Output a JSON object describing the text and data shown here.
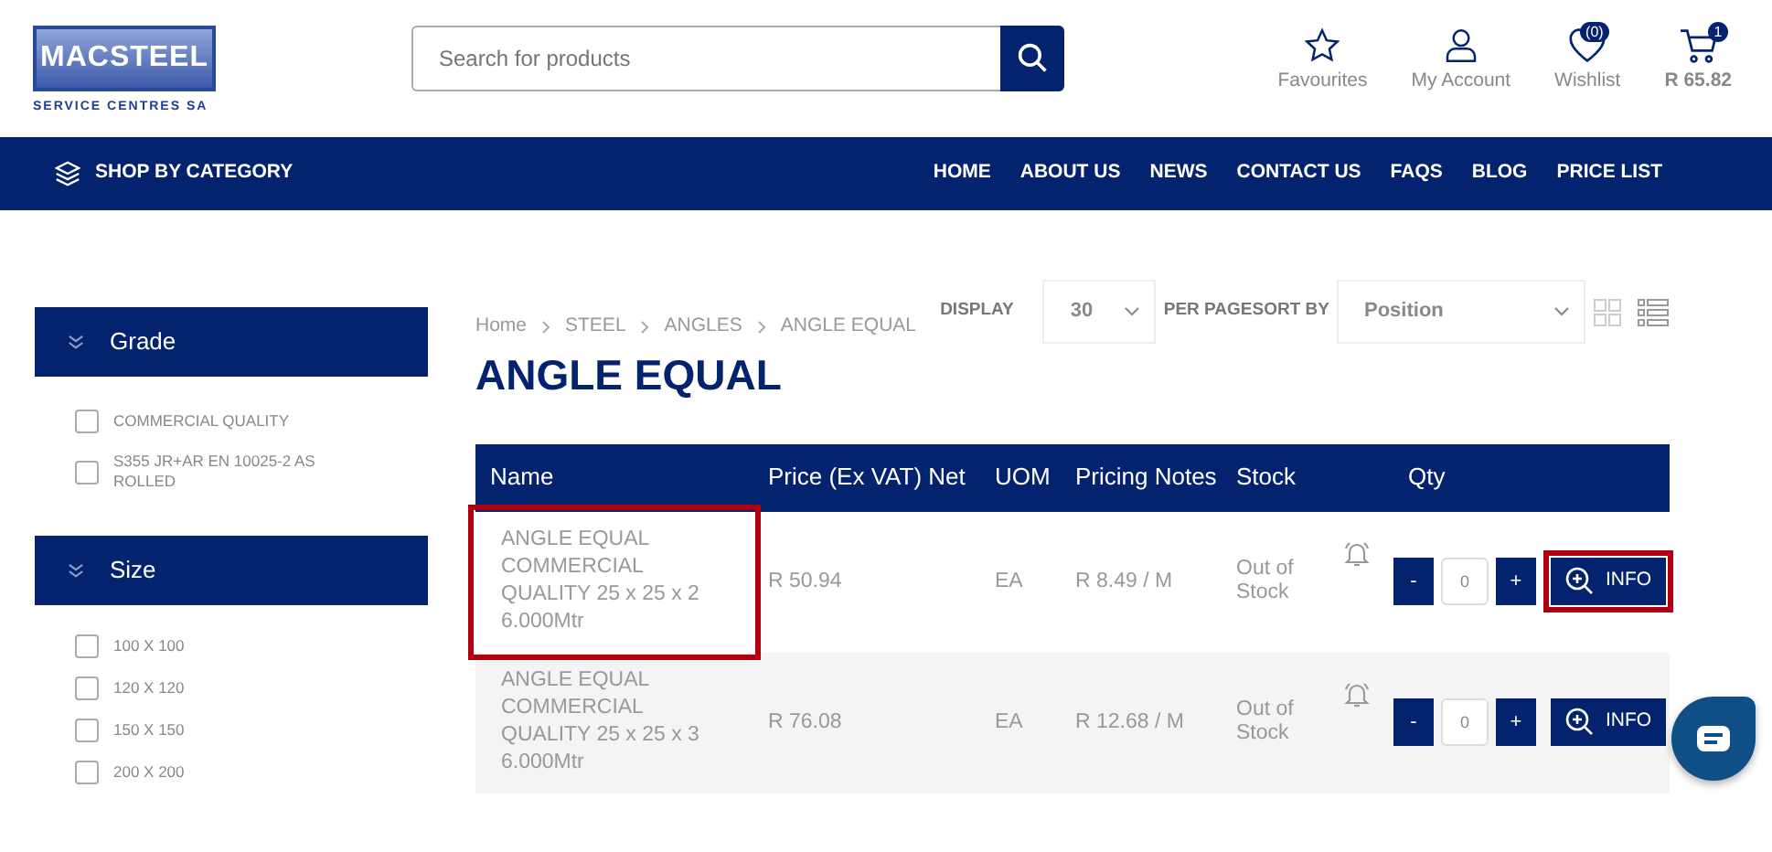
{
  "logo": {
    "name": "MACSTEEL",
    "tagline": "SERVICE CENTRES SA"
  },
  "search": {
    "placeholder": "Search for products"
  },
  "header_links": [
    {
      "kind": "favourites",
      "label": "Favourites"
    },
    {
      "kind": "account",
      "label": "My Account"
    },
    {
      "kind": "wishlist",
      "label": "Wishlist",
      "badge": "(0)"
    },
    {
      "kind": "cart",
      "label": "R 65.82",
      "badge": "1"
    }
  ],
  "navbar": {
    "category_button": "SHOP BY CATEGORY",
    "links": [
      "HOME",
      "ABOUT US",
      "NEWS",
      "CONTACT US",
      "FAQS",
      "BLOG",
      "PRICE LIST"
    ]
  },
  "filters": [
    {
      "title": "Grade",
      "options": [
        {
          "label": "COMMERCIAL QUALITY",
          "checked": false
        },
        {
          "label": "S355 JR+AR EN 10025-2 AS ROLLED",
          "checked": false
        }
      ]
    },
    {
      "title": "Size",
      "options": [
        {
          "label": "100 X 100",
          "checked": false
        },
        {
          "label": "120 X 120",
          "checked": false
        },
        {
          "label": "150 X 150",
          "checked": false
        },
        {
          "label": "200 X 200",
          "checked": false
        }
      ]
    }
  ],
  "breadcrumb": [
    "Home",
    "STEEL",
    "ANGLES",
    "ANGLE EQUAL"
  ],
  "toolbar": {
    "display_label": "DISPLAY",
    "per_page": "30",
    "sort_label": "PER PAGESORT BY",
    "sort": "Position"
  },
  "page_title": "ANGLE EQUAL",
  "table": {
    "columns": [
      "Name",
      "Price (Ex VAT) Net",
      "UOM",
      "Pricing Notes",
      "Stock",
      "Qty"
    ],
    "rows": [
      {
        "name": "ANGLE EQUAL COMMERCIAL QUALITY 25 x 25 x 2 6.000Mtr",
        "price": "R 50.94",
        "uom": "EA",
        "notes": "R 8.49 / M",
        "stock": "Out of Stock",
        "minus": "-",
        "qty": "0",
        "plus": "+",
        "info": "INFO",
        "name_highlighted": true,
        "info_highlighted": true
      },
      {
        "name": "ANGLE EQUAL COMMERCIAL QUALITY 25 x 25 x 3 6.000Mtr",
        "price": "R 76.08",
        "uom": "EA",
        "notes": "R 12.68 / M",
        "stock": "Out of Stock",
        "minus": "-",
        "qty": "0",
        "plus": "+",
        "info": "INFO",
        "name_highlighted": false,
        "info_highlighted": false
      }
    ]
  }
}
